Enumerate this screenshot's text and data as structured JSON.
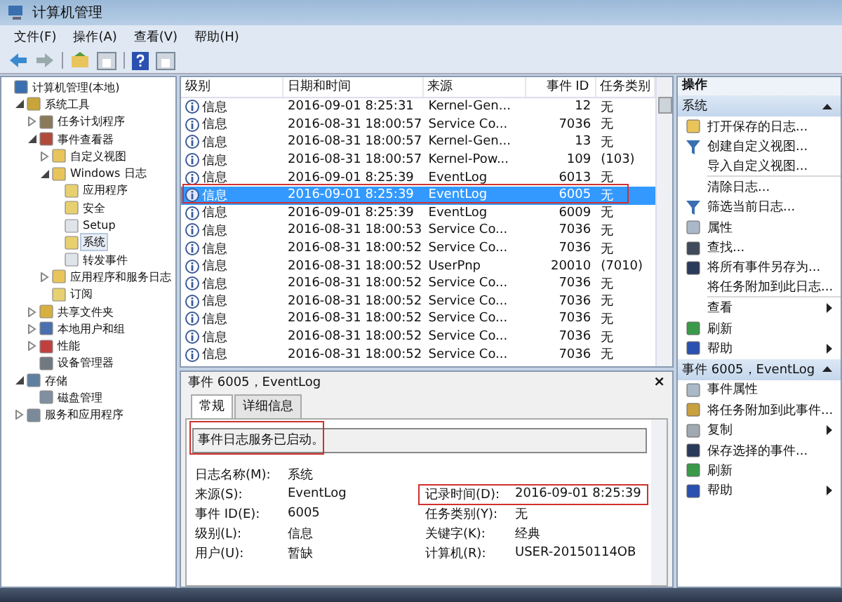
{
  "window": {
    "title": "计算机管理"
  },
  "menu": [
    "文件(F)",
    "操作(A)",
    "查看(V)",
    "帮助(H)"
  ],
  "tree": [
    {
      "label": "计算机管理(本地)",
      "kind": "computer",
      "selected": false,
      "children": [
        {
          "label": "系统工具",
          "kind": "tools",
          "expanded": true,
          "selected": false,
          "children": [
            {
              "label": "任务计划程序",
              "kind": "clock",
              "expanded": false,
              "selected": false
            },
            {
              "label": "事件查看器",
              "kind": "viewer",
              "expanded": true,
              "selected": false,
              "children": [
                {
                  "label": "自定义视图",
                  "kind": "folder",
                  "expanded": false,
                  "selected": false
                },
                {
                  "label": "Windows 日志",
                  "kind": "folder",
                  "expanded": true,
                  "selected": false,
                  "children": [
                    {
                      "label": "应用程序",
                      "kind": "log",
                      "selected": false
                    },
                    {
                      "label": "安全",
                      "kind": "log",
                      "selected": false
                    },
                    {
                      "label": "Setup",
                      "kind": "blank",
                      "selected": false
                    },
                    {
                      "label": "系统",
                      "kind": "log",
                      "selected": true
                    },
                    {
                      "label": "转发事件",
                      "kind": "blank",
                      "selected": false
                    }
                  ]
                },
                {
                  "label": "应用程序和服务日志",
                  "kind": "folder",
                  "expanded": false,
                  "selected": false
                },
                {
                  "label": "订阅",
                  "kind": "log",
                  "selected": false
                }
              ]
            },
            {
              "label": "共享文件夹",
              "kind": "share",
              "expanded": false,
              "selected": false
            },
            {
              "label": "本地用户和组",
              "kind": "users",
              "expanded": false,
              "selected": false
            },
            {
              "label": "性能",
              "kind": "perf",
              "expanded": false,
              "selected": false
            },
            {
              "label": "设备管理器",
              "kind": "device",
              "selected": false
            }
          ]
        },
        {
          "label": "存储",
          "kind": "storage",
          "expanded": true,
          "selected": false,
          "children": [
            {
              "label": "磁盘管理",
              "kind": "disk",
              "selected": false
            }
          ]
        },
        {
          "label": "服务和应用程序",
          "kind": "services",
          "expanded": false,
          "selected": false
        }
      ]
    }
  ],
  "table": {
    "columns": [
      "级别",
      "日期和时间",
      "来源",
      "事件 ID",
      "任务类别"
    ],
    "rows": [
      {
        "level": "信息",
        "date": "2016-09-01 8:25:31",
        "source": "Kernel-Gen...",
        "id": "12",
        "task": "无",
        "selected": false
      },
      {
        "level": "信息",
        "date": "2016-08-31 18:00:57",
        "source": "Service Co...",
        "id": "7036",
        "task": "无",
        "selected": false
      },
      {
        "level": "信息",
        "date": "2016-08-31 18:00:57",
        "source": "Kernel-Gen...",
        "id": "13",
        "task": "无",
        "selected": false
      },
      {
        "level": "信息",
        "date": "2016-08-31 18:00:57",
        "source": "Kernel-Pow...",
        "id": "109",
        "task": "(103)",
        "selected": false
      },
      {
        "level": "信息",
        "date": "2016-09-01 8:25:39",
        "source": "EventLog",
        "id": "6013",
        "task": "无",
        "selected": false
      },
      {
        "level": "信息",
        "date": "2016-09-01 8:25:39",
        "source": "EventLog",
        "id": "6005",
        "task": "无",
        "selected": true
      },
      {
        "level": "信息",
        "date": "2016-09-01 8:25:39",
        "source": "EventLog",
        "id": "6009",
        "task": "无",
        "selected": false
      },
      {
        "level": "信息",
        "date": "2016-08-31 18:00:53",
        "source": "Service Co...",
        "id": "7036",
        "task": "无",
        "selected": false
      },
      {
        "level": "信息",
        "date": "2016-08-31 18:00:52",
        "source": "Service Co...",
        "id": "7036",
        "task": "无",
        "selected": false
      },
      {
        "level": "信息",
        "date": "2016-08-31 18:00:52",
        "source": "UserPnp",
        "id": "20010",
        "task": "(7010)",
        "selected": false
      },
      {
        "level": "信息",
        "date": "2016-08-31 18:00:52",
        "source": "Service Co...",
        "id": "7036",
        "task": "无",
        "selected": false
      },
      {
        "level": "信息",
        "date": "2016-08-31 18:00:52",
        "source": "Service Co...",
        "id": "7036",
        "task": "无",
        "selected": false
      },
      {
        "level": "信息",
        "date": "2016-08-31 18:00:52",
        "source": "Service Co...",
        "id": "7036",
        "task": "无",
        "selected": false
      },
      {
        "level": "信息",
        "date": "2016-08-31 18:00:52",
        "source": "Service Co...",
        "id": "7036",
        "task": "无",
        "selected": false
      },
      {
        "level": "信息",
        "date": "2016-08-31 18:00:52",
        "source": "Service Co...",
        "id": "7036",
        "task": "无",
        "selected": false
      }
    ]
  },
  "details": {
    "title": "事件 6005，EventLog",
    "close": "×",
    "tabs": [
      {
        "label": "常规",
        "selected": true
      },
      {
        "label": "详细信息",
        "selected": false
      }
    ],
    "message": "事件日志服务已启动。",
    "message_highlighted": true,
    "fields": [
      {
        "label": "日志名称(M):",
        "value": "系统",
        "highlighted": false
      },
      {
        "label": "来源(S):",
        "value": "EventLog",
        "right_label": "记录时间(D):",
        "right_value": "2016-09-01 8:25:39",
        "highlighted": true
      },
      {
        "label": "事件 ID(E):",
        "value": "6005",
        "right_label": "任务类别(Y):",
        "right_value": "无",
        "highlighted": false
      },
      {
        "label": "级别(L):",
        "value": "信息",
        "right_label": "关键字(K):",
        "right_value": "经典",
        "highlighted": false
      },
      {
        "label": "用户(U):",
        "value": "暂缺",
        "right_label": "计算机(R):",
        "right_value": "USER-20150114OB",
        "highlighted": false
      }
    ]
  },
  "actions": {
    "title": "操作",
    "sections": [
      {
        "title": "系统",
        "items": [
          {
            "label": "打开保存的日志...",
            "kind": "folder",
            "submenu": false,
            "divider_after": false
          },
          {
            "label": "创建自定义视图...",
            "kind": "filter",
            "submenu": false,
            "divider_after": false
          },
          {
            "label": "导入自定义视图...",
            "kind": "plain",
            "submenu": false,
            "divider_after": true
          },
          {
            "label": "清除日志...",
            "kind": "plain",
            "submenu": false,
            "divider_after": false
          },
          {
            "label": "筛选当前日志...",
            "kind": "filter",
            "submenu": false,
            "divider_after": false
          },
          {
            "label": "属性",
            "kind": "properties",
            "submenu": false,
            "divider_after": false
          },
          {
            "label": "查找...",
            "kind": "binoculars",
            "submenu": false,
            "divider_after": false
          },
          {
            "label": "将所有事件另存为...",
            "kind": "save",
            "submenu": false,
            "divider_after": false
          },
          {
            "label": "将任务附加到此日志...",
            "kind": "plain",
            "submenu": false,
            "divider_after": true
          },
          {
            "label": "查看",
            "kind": "plain",
            "submenu": true,
            "divider_after": false
          },
          {
            "label": "刷新",
            "kind": "refresh",
            "submenu": false,
            "divider_after": false
          },
          {
            "label": "帮助",
            "kind": "help",
            "submenu": true,
            "divider_after": false
          }
        ]
      },
      {
        "title": "事件 6005，EventLog",
        "items": [
          {
            "label": "事件属性",
            "kind": "properties",
            "submenu": false,
            "divider_after": false
          },
          {
            "label": "将任务附加到此事件...",
            "kind": "task",
            "submenu": false,
            "divider_after": false
          },
          {
            "label": "复制",
            "kind": "copy",
            "submenu": true,
            "divider_after": false
          },
          {
            "label": "保存选择的事件...",
            "kind": "save",
            "submenu": false,
            "divider_after": false
          },
          {
            "label": "刷新",
            "kind": "refresh",
            "submenu": false,
            "divider_after": false
          },
          {
            "label": "帮助",
            "kind": "help",
            "submenu": true,
            "divider_after": false
          }
        ]
      }
    ]
  }
}
